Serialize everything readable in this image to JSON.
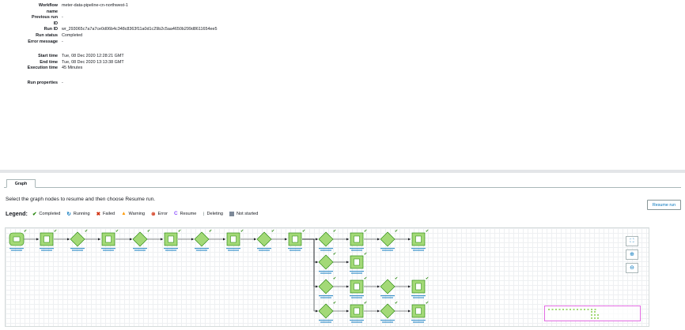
{
  "details": {
    "workflow_name_label_1": "Workflow",
    "workflow_name_label_2": "name",
    "workflow_name": "meter-data-pipeline-cn-northwest-1",
    "previous_run_label_1": "Previous run",
    "previous_run_label_2": "ID",
    "previous_run_id": "-",
    "run_id_label": "Run ID",
    "run_id": "wr_293065c7a7a7ce0d06b4c348c8363f11a0d1c29b2c5aa4650b299d8611654ee5",
    "run_status_label": "Run status",
    "run_status": "Completed",
    "error_message_label": "Error message",
    "error_message": "-",
    "start_time_label": "Start time",
    "start_time": "Tue, 08 Dec 2020 12:28:21 GMT",
    "end_time_label": "End time",
    "end_time": "Tue, 08 Dec 2020 13:13:38 GMT",
    "execution_time_label": "Execution time",
    "execution_time": "45 Minutes",
    "run_properties_label": "Run properties",
    "run_properties": "-"
  },
  "tabs": {
    "graph": "Graph"
  },
  "instructions": "Select the graph nodes to resume and then choose Resume run.",
  "legend": {
    "title": "Legend:",
    "items": [
      {
        "icon": "✔",
        "label": "Completed",
        "color": "#1d8102"
      },
      {
        "icon": "↻",
        "label": "Running",
        "color": "#0073bb"
      },
      {
        "icon": "✖",
        "label": "Failed",
        "color": "#d13212"
      },
      {
        "icon": "▲",
        "label": "Warning",
        "color": "#ff9900"
      },
      {
        "icon": "⊗",
        "label": "Error",
        "color": "#d13212"
      },
      {
        "icon": "C",
        "label": "Resume",
        "color": "#8c4fff"
      },
      {
        "icon": "⁝",
        "label": "Deleting",
        "color": "#879596"
      },
      {
        "icon": "■",
        "label": "Not started",
        "color": "#7d8998"
      }
    ]
  },
  "buttons": {
    "resume_run": "Resume run"
  },
  "graph_controls": {
    "fit": "⛶",
    "zoom_in": "⊕",
    "zoom_out": "⊖"
  },
  "colors": {
    "node_fill": "#a3d977",
    "node_stroke": "#1d8102",
    "edge": "#16191f",
    "label": "#0073bb",
    "minimap": "#e36ce3"
  }
}
